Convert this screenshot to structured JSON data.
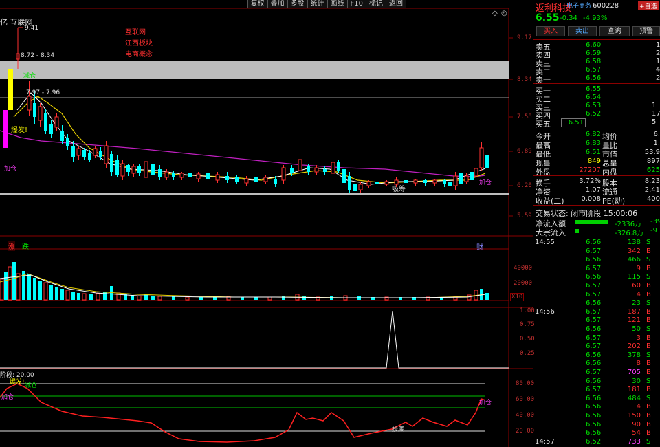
{
  "toolbar": [
    "复权",
    "叠加",
    "多股",
    "统计",
    "画线",
    "F10",
    "标记",
    "返回"
  ],
  "chart": {
    "title_left": "亿 互联网",
    "concepts": [
      "互联网",
      "江西板块",
      "电商概念"
    ],
    "price_ticks": [
      "9.17",
      "8.34",
      "7.58",
      "6.89",
      "6.20",
      "5.59"
    ],
    "annotations": {
      "high": "9.41",
      "range1": "8.72 - 8.34",
      "range2": "7.97 - 7.96",
      "mid_label": "减仓",
      "burst": "爆发!",
      "add_pos": "加仓",
      "absorb": "吸筹",
      "add_pos_right": "加仓"
    },
    "vol_ticks": [
      "40000",
      "20000"
    ],
    "vol_unit": "X10",
    "vol_tags": [
      "涨",
      "跌"
    ],
    "vol_tag_right": "财",
    "ind1_ticks": [
      "1.00",
      "0.75",
      "0.50",
      "0.25"
    ],
    "ind2_title": "阶段: 20.00",
    "ind2_ticks": [
      "80.00",
      "60.00",
      "40.00",
      "20.00"
    ],
    "ind2_labels": {
      "burst": "爆发!",
      "cut": "减仓",
      "add": "加仓",
      "bottom": "抄底",
      "add_right": "加仓"
    }
  },
  "stock": {
    "name": "返利科技",
    "sector": "电子商务",
    "code": "600228",
    "add_watch": "+自选",
    "price": "6.55",
    "change": "-0.34",
    "change_pct": "-4.93%",
    "buttons": [
      "买入",
      "卖出",
      "查询",
      "预警"
    ]
  },
  "asks": [
    {
      "label": "卖五",
      "price": "6.60",
      "vol": "1"
    },
    {
      "label": "卖四",
      "price": "6.59",
      "vol": "2"
    },
    {
      "label": "卖三",
      "price": "6.58",
      "vol": "1"
    },
    {
      "label": "卖二",
      "price": "6.57",
      "vol": "4"
    },
    {
      "label": "卖一",
      "price": "6.56",
      "vol": "2"
    }
  ],
  "bids": [
    {
      "label": "买一",
      "price": "6.55",
      "vol": ""
    },
    {
      "label": "买二",
      "price": "6.54",
      "vol": ""
    },
    {
      "label": "买三",
      "price": "6.53",
      "vol": "1"
    },
    {
      "label": "买四",
      "price": "6.52",
      "vol": "17"
    },
    {
      "label": "买五",
      "price": "6.51",
      "vol": "5"
    }
  ],
  "stats": [
    {
      "l1": "今开",
      "v1": "6.82",
      "l2": "均价",
      "v2": "6."
    },
    {
      "l1": "最高",
      "v1": "6.83",
      "l2": "量比",
      "v2": "1."
    },
    {
      "l1": "最低",
      "v1": "6.51",
      "l2": "市值",
      "v2": "53.9"
    },
    {
      "l1": "现量",
      "v1": "849",
      "l2": "总量",
      "v2": "897"
    },
    {
      "l1": "外盘",
      "v1": "27207",
      "l2": "内盘",
      "v2": "625"
    }
  ],
  "stats2": [
    {
      "l1": "换手",
      "v1": "3.72%",
      "l2": "股本",
      "v2": "8.23"
    },
    {
      "l1": "净资",
      "v1": "1.07",
      "l2": "流通",
      "v2": "2.41"
    },
    {
      "l1": "收益(二)",
      "v1": "0.008",
      "l2": "PE(动)",
      "v2": "400"
    }
  ],
  "trade_status": "交易状态: 闭市阶段 15:00:06",
  "flows": [
    {
      "label": "净流入额",
      "val": "-2336万",
      "tail": "-39"
    },
    {
      "label": "大宗流入",
      "val": "-326.8万",
      "tail": "-9"
    }
  ],
  "ticks": [
    {
      "t": "14:55",
      "p": "6.56",
      "v": "138",
      "s": "S"
    },
    {
      "t": "",
      "p": "6.57",
      "v": "342",
      "s": "B"
    },
    {
      "t": "",
      "p": "6.56",
      "v": "466",
      "s": "S"
    },
    {
      "t": "",
      "p": "6.57",
      "v": "9",
      "s": "B"
    },
    {
      "t": "",
      "p": "6.56",
      "v": "115",
      "s": "S"
    },
    {
      "t": "",
      "p": "6.57",
      "v": "60",
      "s": "B"
    },
    {
      "t": "",
      "p": "6.57",
      "v": "4",
      "s": "B"
    },
    {
      "t": "",
      "p": "6.56",
      "v": "23",
      "s": "S"
    },
    {
      "t": "14:56",
      "p": "6.57",
      "v": "187",
      "s": "B"
    },
    {
      "t": "",
      "p": "6.57",
      "v": "121",
      "s": "B"
    },
    {
      "t": "",
      "p": "6.56",
      "v": "50",
      "s": "S"
    },
    {
      "t": "",
      "p": "6.57",
      "v": "3",
      "s": "B"
    },
    {
      "t": "",
      "p": "6.57",
      "v": "202",
      "s": "B"
    },
    {
      "t": "",
      "p": "6.56",
      "v": "378",
      "s": "S"
    },
    {
      "t": "",
      "p": "6.56",
      "v": "8",
      "s": "B"
    },
    {
      "t": "",
      "p": "6.57",
      "v": "705",
      "s": "B"
    },
    {
      "t": "",
      "p": "6.56",
      "v": "30",
      "s": "S"
    },
    {
      "t": "",
      "p": "6.57",
      "v": "181",
      "s": "B"
    },
    {
      "t": "",
      "p": "6.56",
      "v": "484",
      "s": "S"
    },
    {
      "t": "",
      "p": "6.56",
      "v": "4",
      "s": "B"
    },
    {
      "t": "",
      "p": "6.56",
      "v": "150",
      "s": "B"
    },
    {
      "t": "",
      "p": "6.56",
      "v": "90",
      "s": "B"
    },
    {
      "t": "",
      "p": "6.56",
      "v": "54",
      "s": "B"
    },
    {
      "t": "14:57",
      "p": "6.52",
      "v": "733",
      "s": "S"
    }
  ]
}
